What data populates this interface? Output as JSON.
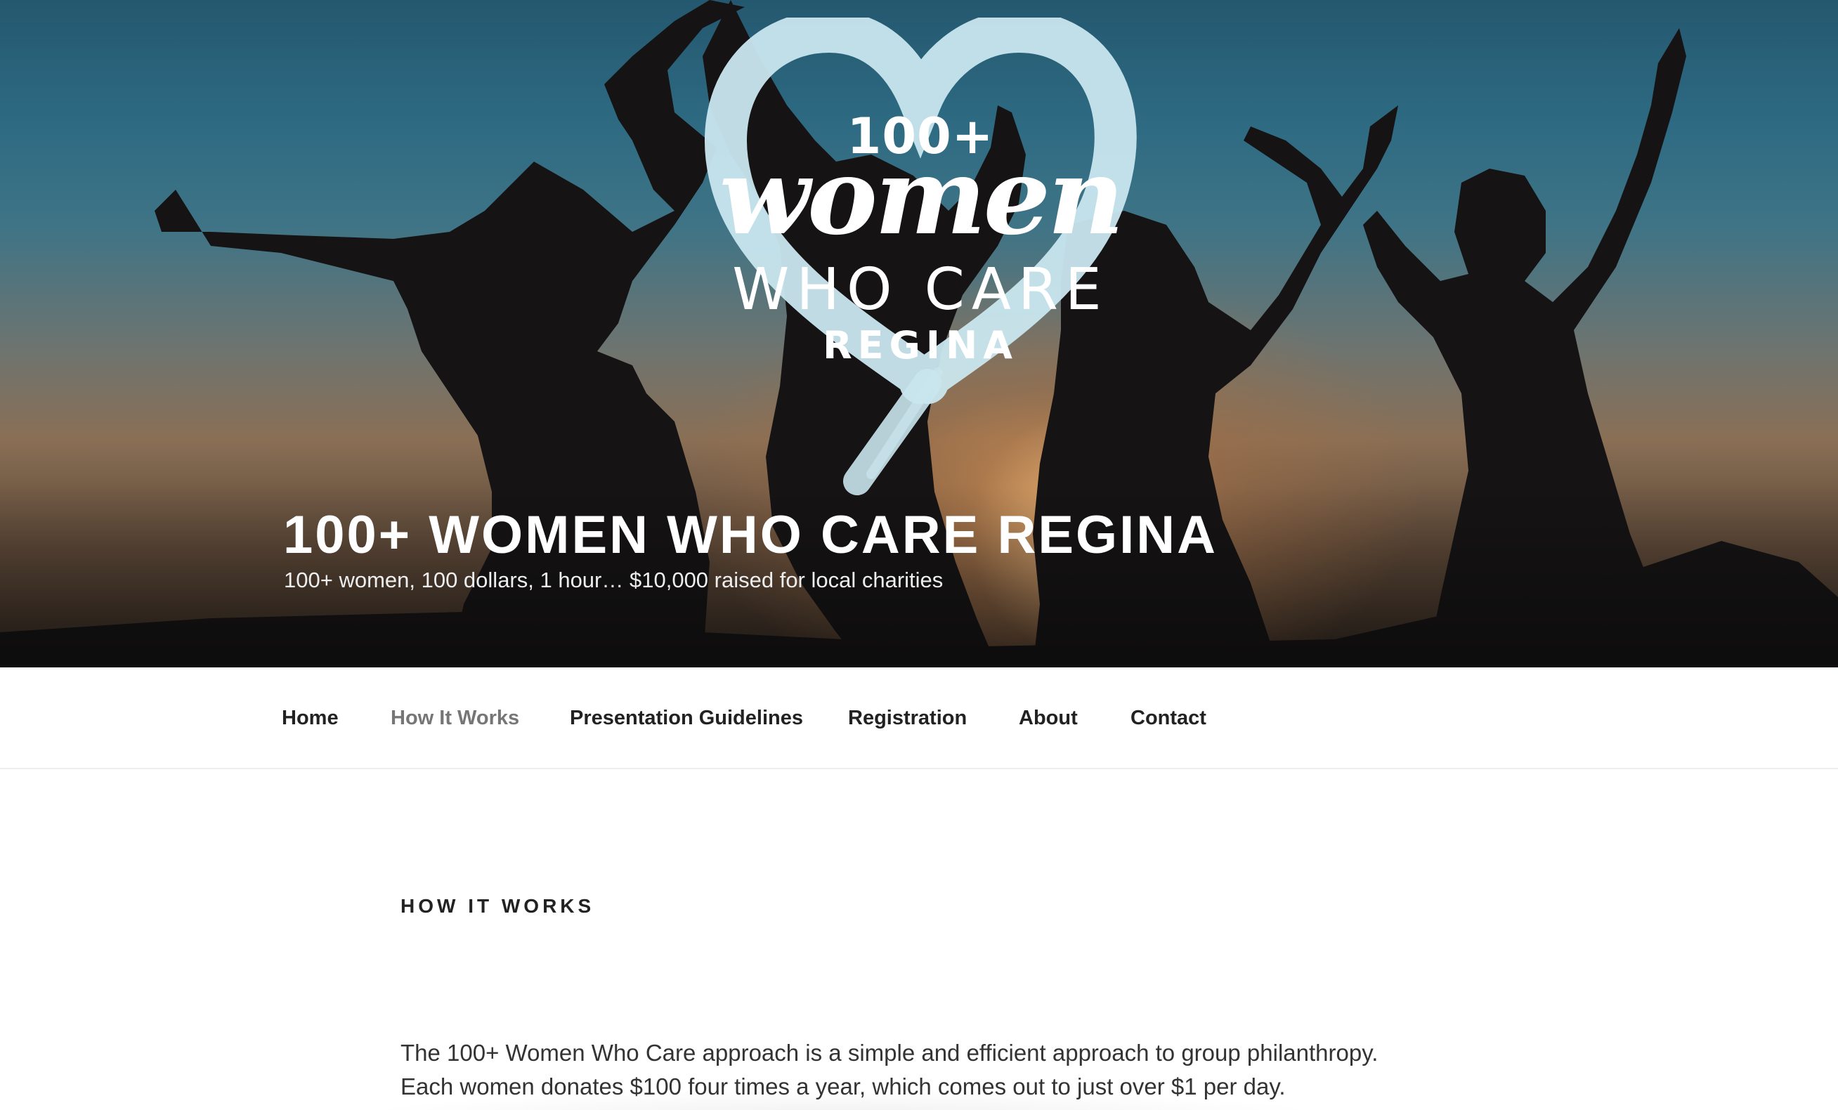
{
  "hero": {
    "logo": {
      "line1": "100+",
      "line2": "women",
      "line3": "WHO CARE",
      "line4": "REGINA"
    },
    "site_title": "100+ WOMEN WHO CARE REGINA",
    "tagline": "100+ women, 100 dollars, 1 hour… $10,000 raised for local charities"
  },
  "nav": {
    "items": [
      {
        "label": "Home"
      },
      {
        "label": "How It Works",
        "current": true
      },
      {
        "label": "Presentation Guidelines"
      },
      {
        "label": "Registration"
      },
      {
        "label": "About"
      },
      {
        "label": "Contact"
      }
    ]
  },
  "content": {
    "title": "HOW IT WORKS",
    "paragraph_line1": "The 100+ Women Who Care approach is a simple and efficient approach to group philanthropy.",
    "paragraph_line2": "Each women donates $100 four times a year, which comes out to just over $1 per day."
  },
  "colors": {
    "logo_heart": "#c9e6ee",
    "nav_text": "#222222",
    "nav_current": "#767676"
  }
}
